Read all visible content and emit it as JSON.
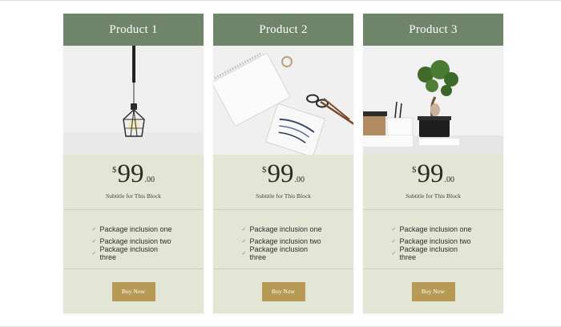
{
  "products": [
    {
      "title": "Product 1",
      "image": "pendant-lamp-photo",
      "currency": "$",
      "price": "99",
      "cents": ".00",
      "subtitle": "Subtitle for This Block",
      "features": [
        "Package inclusion one",
        "Package inclusion two",
        "Package inclusion three"
      ],
      "button_label": "Buy Now"
    },
    {
      "title": "Product 2",
      "image": "notebook-and-scissors-photo",
      "currency": "$",
      "price": "99",
      "cents": ".00",
      "subtitle": "Subtitle for This Block",
      "features": [
        "Package inclusion one",
        "Package inclusion two",
        "Package inclusion three"
      ],
      "button_label": "Buy Now"
    },
    {
      "title": "Product 3",
      "image": "bonsai-desk-photo",
      "currency": "$",
      "price": "99",
      "cents": ".00",
      "subtitle": "Subtitle for This Block",
      "features": [
        "Package inclusion one",
        "Package inclusion two",
        "Package inclusion three"
      ],
      "button_label": "Buy Now"
    }
  ],
  "icons": {
    "feature_bullet": "check-icon"
  },
  "colors": {
    "header_bg": "#6f856a",
    "card_bg": "#e3e5d5",
    "button_bg": "#b79a55",
    "divider": "#cfd1bf"
  }
}
